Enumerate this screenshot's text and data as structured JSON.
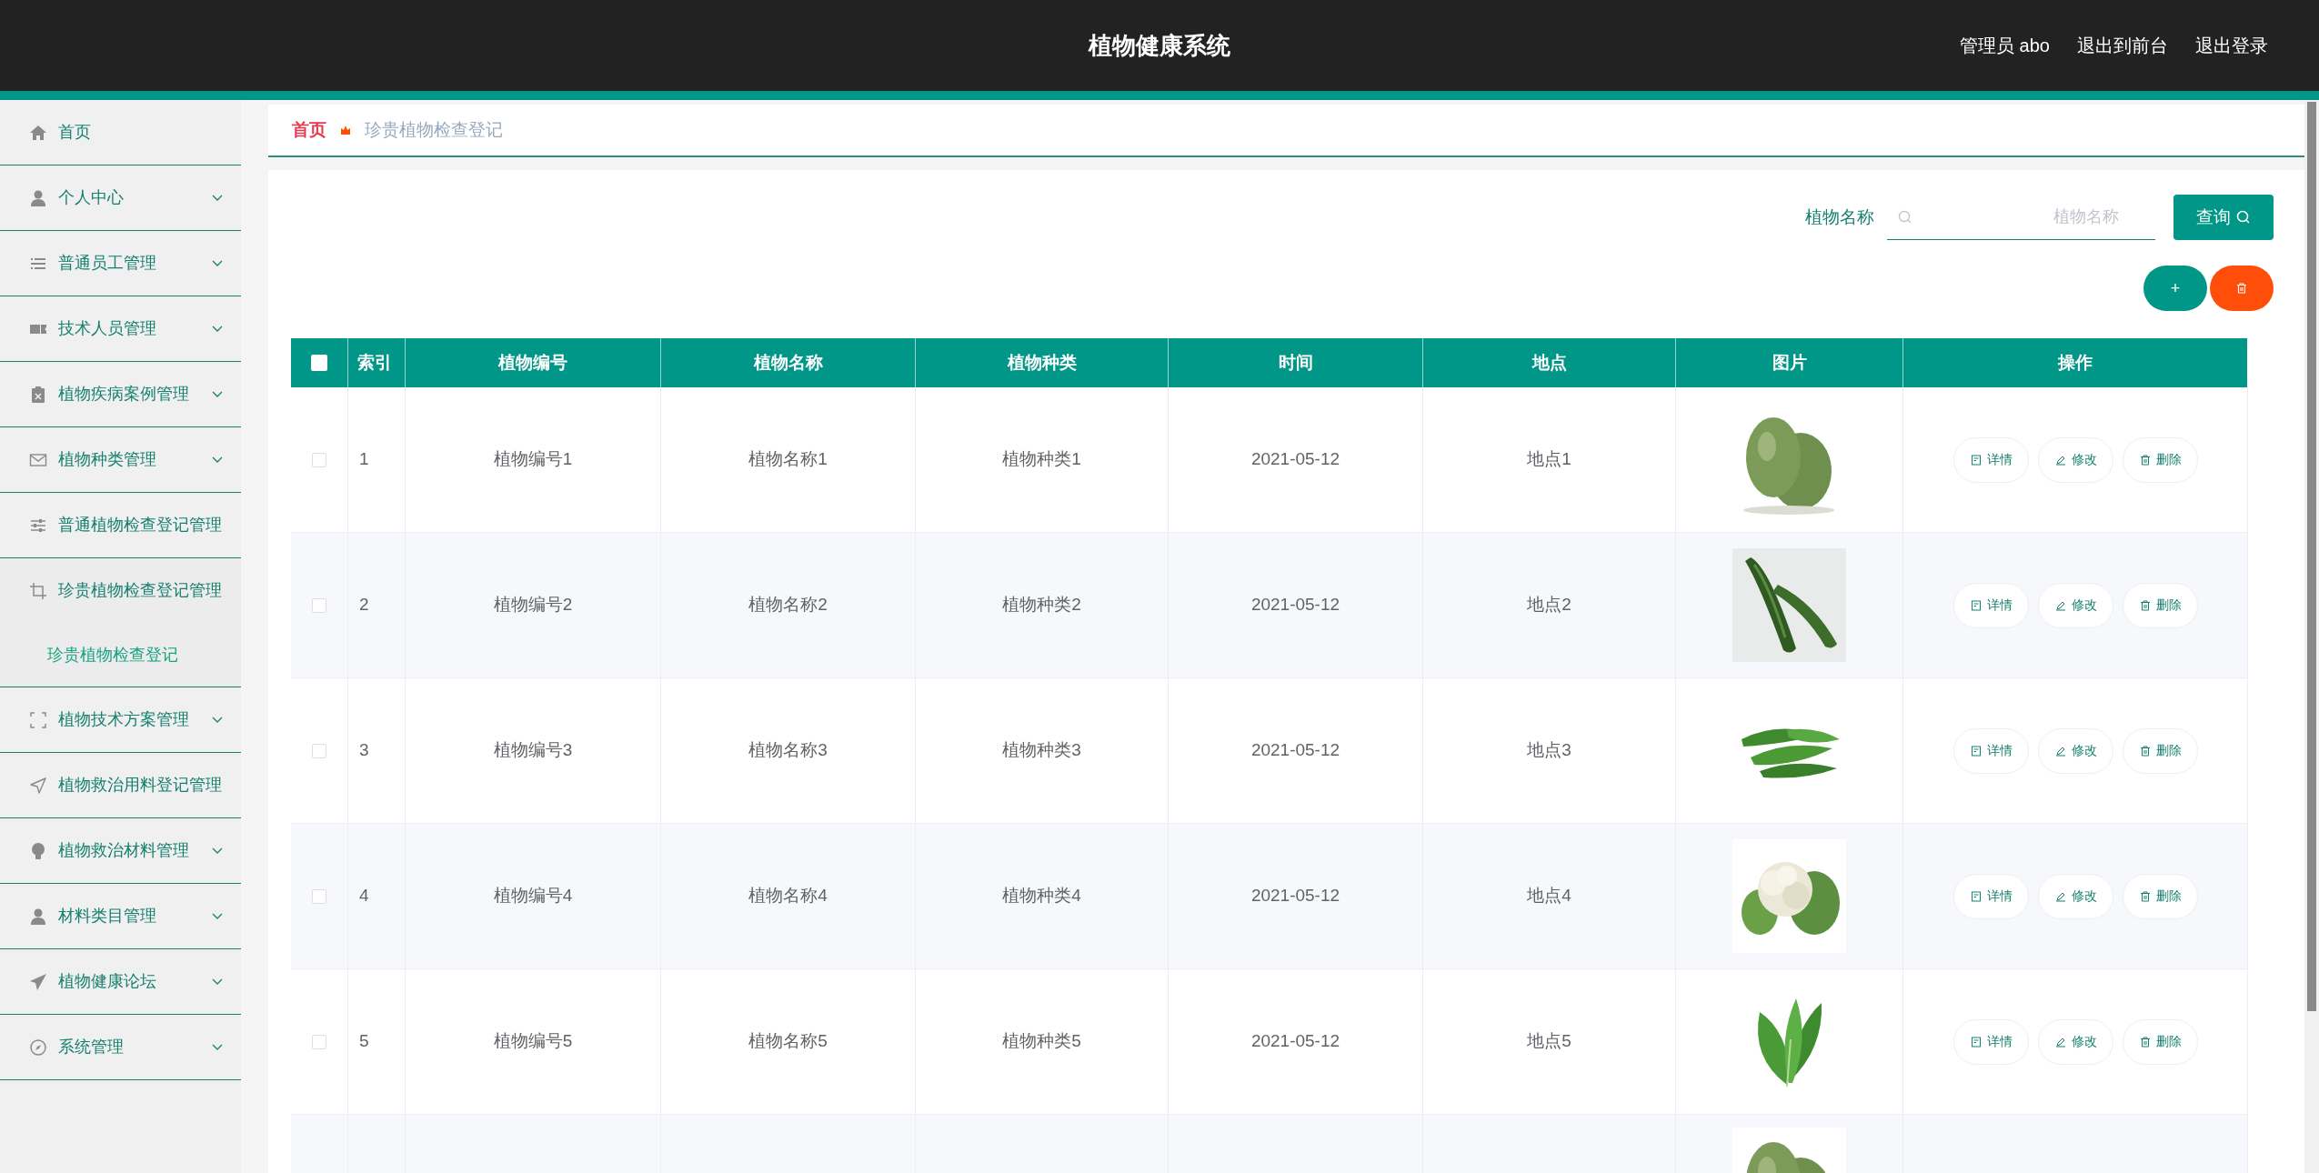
{
  "header": {
    "title": "植物健康系统",
    "user": "管理员 abo",
    "links": [
      "退出到前台",
      "退出登录"
    ]
  },
  "sidebar": {
    "items": [
      {
        "label": "首页",
        "kind": "link"
      },
      {
        "label": "个人中心",
        "kind": "menu"
      },
      {
        "label": "普通员工管理",
        "kind": "menu"
      },
      {
        "label": "技术人员管理",
        "kind": "menu"
      },
      {
        "label": "植物疾病案例管理",
        "kind": "menu"
      },
      {
        "label": "植物种类管理",
        "kind": "menu"
      },
      {
        "label": "普通植物检查登记管理",
        "kind": "link"
      },
      {
        "label": "珍贵植物检查登记管理",
        "kind": "link",
        "expanded": true,
        "children": [
          {
            "label": "珍贵植物检查登记"
          }
        ]
      },
      {
        "label": "植物技术方案管理",
        "kind": "menu"
      },
      {
        "label": "植物救治用料登记管理",
        "kind": "link"
      },
      {
        "label": "植物救治材料管理",
        "kind": "menu"
      },
      {
        "label": "材料类目管理",
        "kind": "menu"
      },
      {
        "label": "植物健康论坛",
        "kind": "menu"
      },
      {
        "label": "系统管理",
        "kind": "menu"
      }
    ]
  },
  "breadcrumb": [
    "首页",
    "珍贵植物检查登记"
  ],
  "search": {
    "label": "植物名称",
    "placeholder": "植物名称",
    "button": "查询"
  },
  "toolbar": {
    "add": "+"
  },
  "table": {
    "select_all": false,
    "columns": [
      "索引",
      "植物编号",
      "植物名称",
      "植物种类",
      "时间",
      "地点",
      "图片",
      "操作"
    ],
    "rows": [
      {
        "selected": false,
        "cells": [
          "1",
          "植物编号1",
          "植物名称1",
          "植物种类1",
          "2021-05-12",
          "地点1"
        ],
        "actions": [
          "详情",
          "修改",
          "删除"
        ]
      },
      {
        "selected": false,
        "cells": [
          "2",
          "植物编号2",
          "植物名称2",
          "植物种类2",
          "2021-05-12",
          "地点2"
        ],
        "actions": [
          "详情",
          "修改",
          "删除"
        ]
      },
      {
        "selected": false,
        "cells": [
          "3",
          "植物编号3",
          "植物名称3",
          "植物种类3",
          "2021-05-12",
          "地点3"
        ],
        "actions": [
          "详情",
          "修改",
          "删除"
        ]
      },
      {
        "selected": false,
        "cells": [
          "4",
          "植物编号4",
          "植物名称4",
          "植物种类4",
          "2021-05-12",
          "地点4"
        ],
        "actions": [
          "详情",
          "修改",
          "删除"
        ]
      },
      {
        "selected": false,
        "cells": [
          "5",
          "植物编号5",
          "植物名称5",
          "植物种类5",
          "2021-05-12",
          "地点5"
        ],
        "actions": [
          "详情",
          "修改",
          "删除"
        ]
      }
    ]
  }
}
